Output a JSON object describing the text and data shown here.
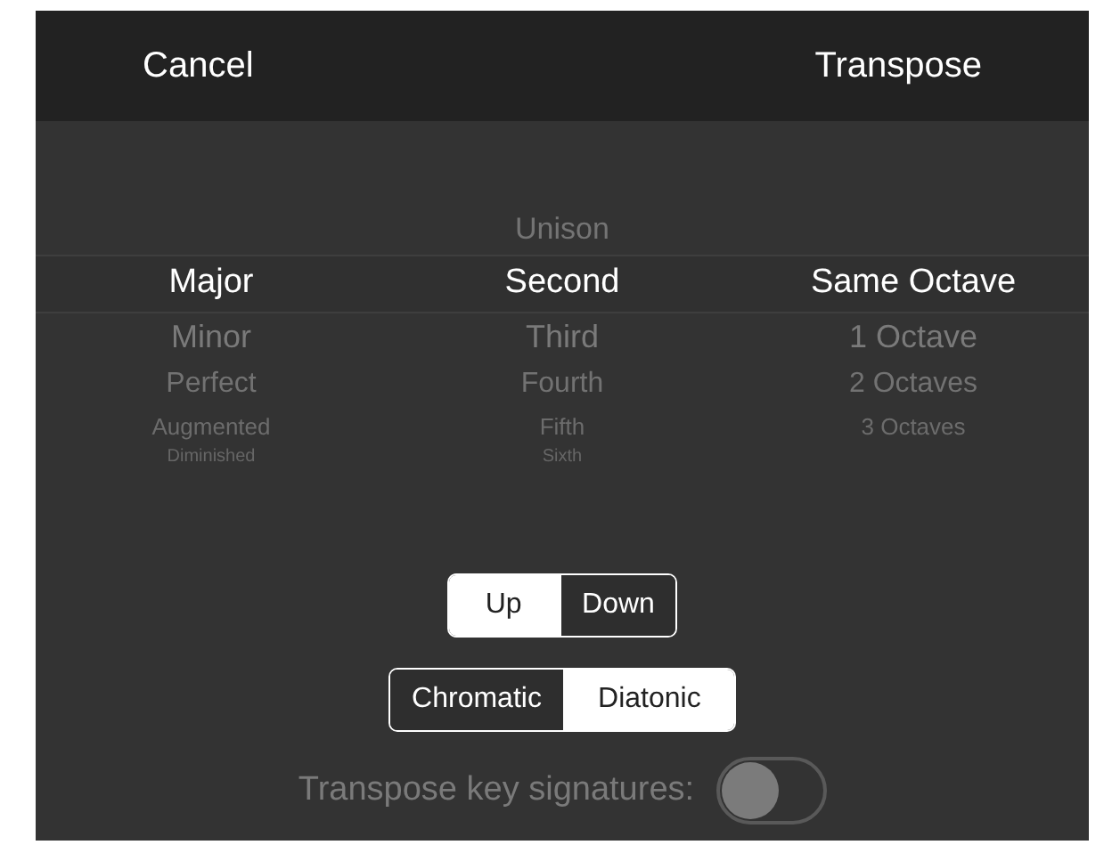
{
  "nav_bar": {
    "cancel": "Cancel",
    "action": "Transpose"
  },
  "picker": {
    "columns": [
      {
        "items": [
          {
            "label": "Major",
            "selected": true
          },
          {
            "label": "Minor",
            "selected": false
          },
          {
            "label": "Perfect",
            "selected": false
          },
          {
            "label": "Augmented",
            "selected": false
          },
          {
            "label": "Diminished",
            "selected": false
          }
        ]
      },
      {
        "items": [
          {
            "label": "Unison",
            "selected": false
          },
          {
            "label": "Second",
            "selected": true
          },
          {
            "label": "Third",
            "selected": false
          },
          {
            "label": "Fourth",
            "selected": false
          },
          {
            "label": "Fifth",
            "selected": false
          },
          {
            "label": "Sixth",
            "selected": false
          }
        ]
      },
      {
        "items": [
          {
            "label": "Same Octave",
            "selected": true
          },
          {
            "label": "1 Octave",
            "selected": false
          },
          {
            "label": "2 Octaves",
            "selected": false
          },
          {
            "label": "3 Octaves",
            "selected": false
          }
        ]
      }
    ]
  },
  "direction": [
    {
      "label": "Up",
      "selected": true
    },
    {
      "label": "Down",
      "selected": false
    }
  ],
  "mode": [
    {
      "label": "Chromatic",
      "selected": false
    },
    {
      "label": "Diatonic",
      "selected": true
    }
  ],
  "key_signatures": {
    "label": "Transpose key signatures:",
    "on": false,
    "disabled": true
  }
}
